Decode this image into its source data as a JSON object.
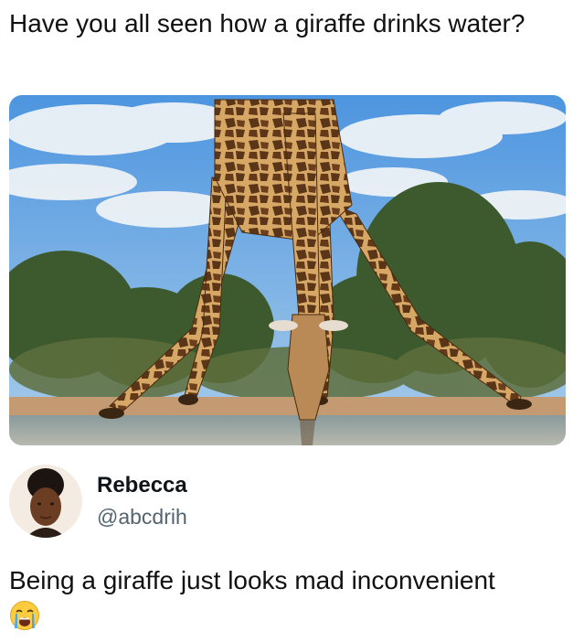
{
  "post": {
    "caption": "Have you all seen how a giraffe drinks water?"
  },
  "tweet": {
    "display_name": "Rebecca",
    "handle": "@abcdrih",
    "text": "Being a giraffe just looks mad inconvenient",
    "emoji_icon": "loudly-crying-face-icon"
  },
  "colors": {
    "sky": "#5fa3e3",
    "giraffe_tan": "#c99a5a",
    "giraffe_patch": "#5a3517",
    "foliage": "#3d5a2e",
    "handle_gray": "#536471"
  }
}
